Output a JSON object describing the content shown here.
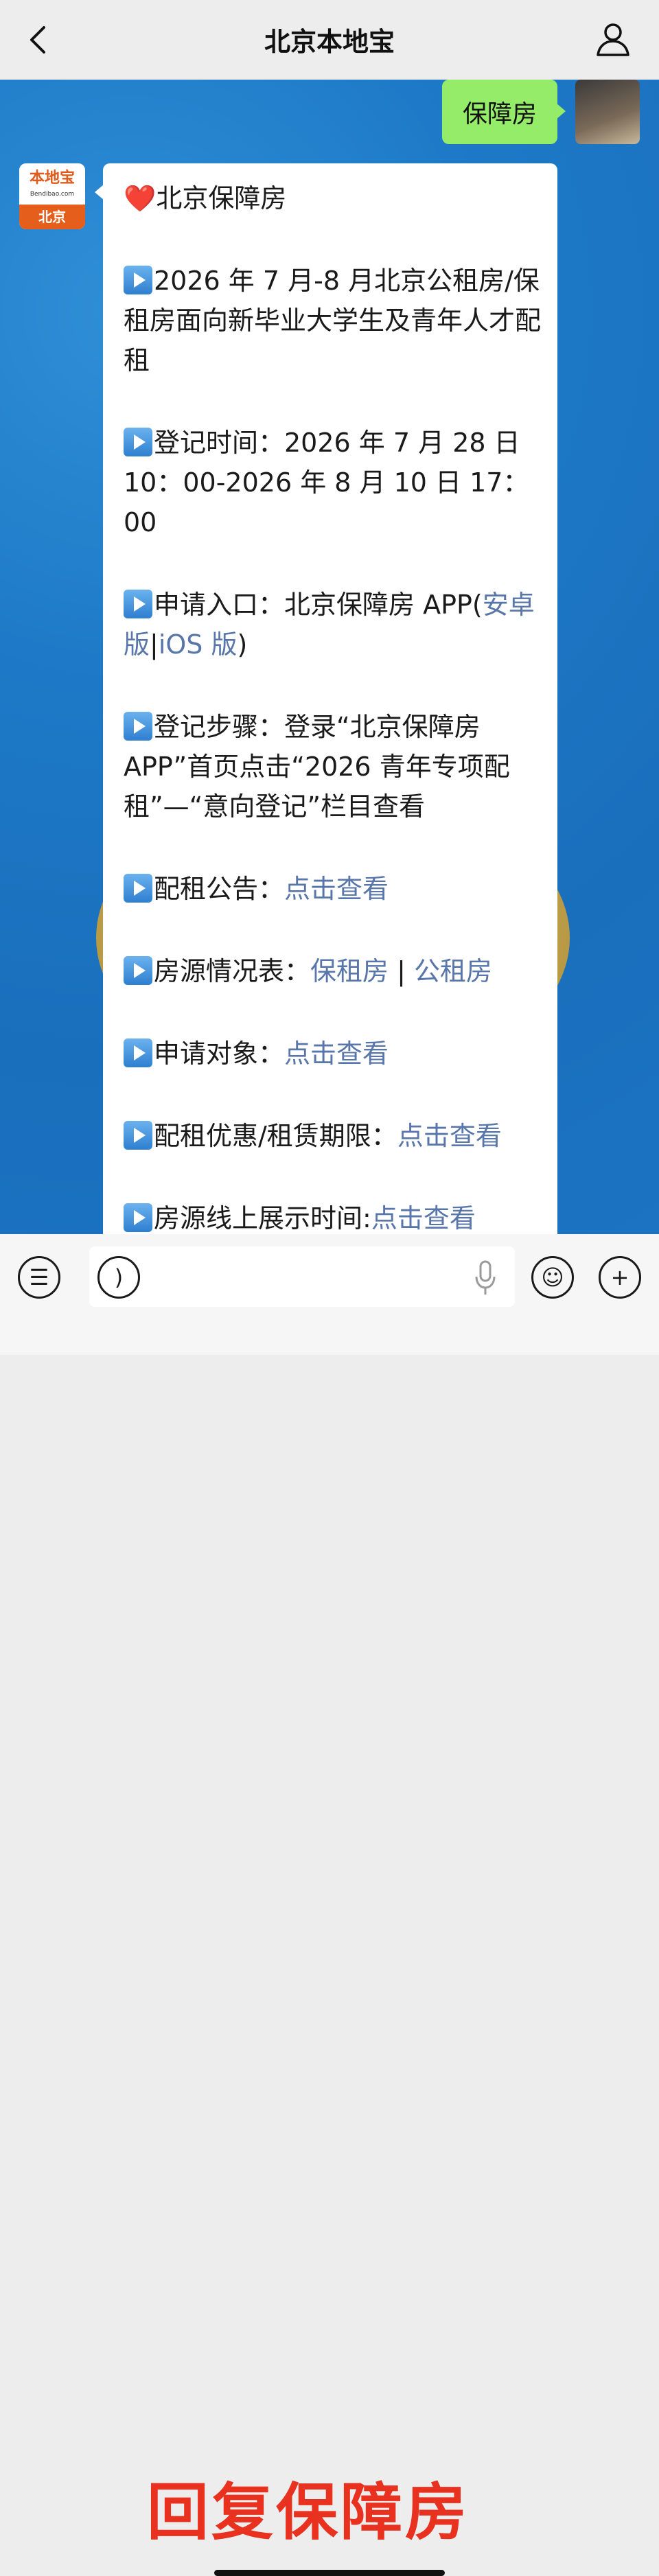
{
  "header": {
    "title": "北京本地宝"
  },
  "chat": {
    "outgoing": {
      "text": "保障房"
    },
    "incoming_avatar": {
      "top_text": "本地宝",
      "sub_text": "Bendibao.com",
      "bottom_text": "北京"
    },
    "incoming": {
      "title": "北京保障房",
      "items": [
        {
          "text": "2026 年 7 月-8 月北京公租房/保租房面向新毕业大学生及青年人才配租"
        },
        {
          "text": "登记时间：2026 年 7 月 28 日 10：00-2026 年 8 月 10 日 17：00"
        },
        {
          "prefix": "申请入口：北京保障房 APP(",
          "link1": "安卓版",
          "sep": "|",
          "link2": "iOS 版",
          "suffix": ")"
        },
        {
          "text": "登记步骤：登录“北京保障房 APP”首页点击“2026 青年专项配租”—“意向登记”栏目查看"
        },
        {
          "prefix": "配租公告：",
          "link": "点击查看"
        },
        {
          "prefix": "房源情况表：",
          "link1": "保租房",
          "sep": " | ",
          "link2": "公租房"
        },
        {
          "prefix": "申请对象：",
          "link": "点击查看"
        },
        {
          "prefix": "配租优惠/租赁期限：",
          "link": "点击查看"
        },
        {
          "prefix": "房源线上展示时间:",
          "link": "点击查看"
        }
      ]
    }
  },
  "overlay_text": "回复保障房",
  "colors": {
    "link": "#5876a9",
    "bubble_out": "#95ec69",
    "overlay": "#e8311e"
  }
}
